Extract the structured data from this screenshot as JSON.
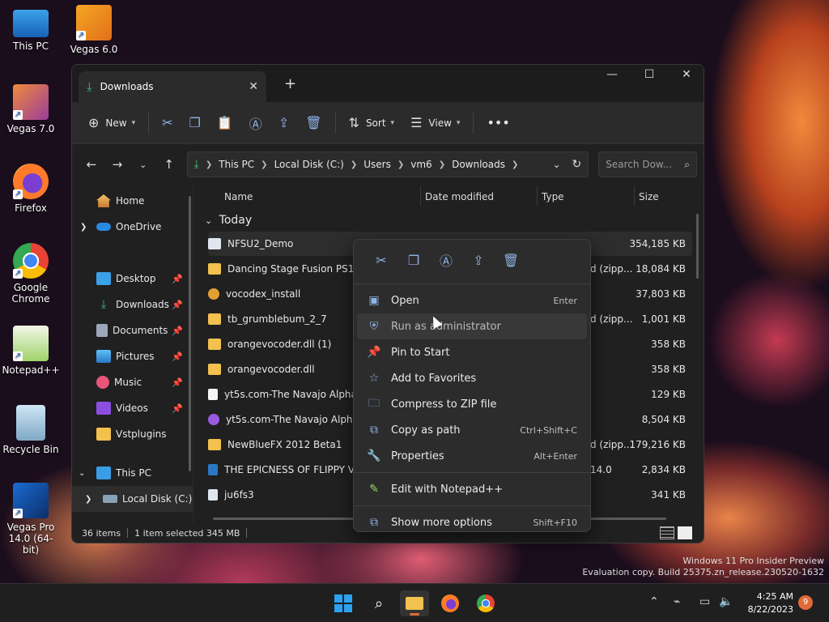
{
  "desktop": {
    "icons": [
      {
        "label": "This PC"
      },
      {
        "label": "Vegas 6.0"
      },
      {
        "label": "Vegas 7.0"
      },
      {
        "label": "Firefox"
      },
      {
        "label": "Google Chrome"
      },
      {
        "label": "Notepad++"
      },
      {
        "label": "Recycle Bin"
      },
      {
        "label": "Vegas Pro 14.0 (64-bit)"
      }
    ]
  },
  "window": {
    "tab_title": "Downloads",
    "toolbar": {
      "new_label": "New",
      "sort_label": "Sort",
      "view_label": "View"
    },
    "breadcrumb": [
      "This PC",
      "Local Disk (C:)",
      "Users",
      "vm6",
      "Downloads"
    ],
    "search_placeholder": "Search Dow...",
    "nav": [
      {
        "label": "Home"
      },
      {
        "label": "OneDrive"
      },
      {
        "label": "Desktop"
      },
      {
        "label": "Downloads"
      },
      {
        "label": "Documents"
      },
      {
        "label": "Pictures"
      },
      {
        "label": "Music"
      },
      {
        "label": "Videos"
      },
      {
        "label": "Vstplugins"
      },
      {
        "label": "This PC"
      },
      {
        "label": "Local Disk (C:)"
      }
    ],
    "columns": {
      "name": "Name",
      "date": "Date modified",
      "type": "Type",
      "size": "Size"
    },
    "group": "Today",
    "files": [
      {
        "name": "NFSU2_Demo",
        "type": "",
        "size": "354,185 KB"
      },
      {
        "name": "Dancing Stage Fusion PS1 (20",
        "type": "d (zipp...",
        "size": "18,084 KB"
      },
      {
        "name": "vocodex_install",
        "type": "",
        "size": "37,803 KB"
      },
      {
        "name": "tb_grumblebum_2_7",
        "type": "d (zipp...",
        "size": "1,001 KB"
      },
      {
        "name": "orangevocoder.dll (1)",
        "type": "",
        "size": "358 KB"
      },
      {
        "name": "orangevocoder.dll",
        "type": "",
        "size": "358 KB"
      },
      {
        "name": "yt5s.com-The Navajo Alphab",
        "type": "",
        "size": "129 KB"
      },
      {
        "name": "yt5s.com-The Navajo Alphab",
        "type": "",
        "size": "8,504 KB"
      },
      {
        "name": "NewBlueFX 2012 Beta1",
        "type": "d (zipp...",
        "size": "179,216 KB"
      },
      {
        "name": "THE EPICNESS OF FLIPPY VEG",
        "type": "14.0",
        "size": "2,834 KB"
      },
      {
        "name": "ju6fs3",
        "type": "",
        "size": "341 KB"
      }
    ],
    "status": {
      "count": "36 items",
      "selected": "1 item selected  345 MB"
    }
  },
  "context_menu": {
    "items": [
      {
        "label": "Open",
        "shortcut": "Enter"
      },
      {
        "label": "Run as administrator",
        "shortcut": ""
      },
      {
        "label": "Pin to Start",
        "shortcut": ""
      },
      {
        "label": "Add to Favorites",
        "shortcut": ""
      },
      {
        "label": "Compress to ZIP file",
        "shortcut": ""
      },
      {
        "label": "Copy as path",
        "shortcut": "Ctrl+Shift+C"
      },
      {
        "label": "Properties",
        "shortcut": "Alt+Enter"
      },
      {
        "label": "Edit with Notepad++",
        "shortcut": ""
      },
      {
        "label": "Show more options",
        "shortcut": "Shift+F10"
      }
    ]
  },
  "watermark": {
    "line1": "Windows 11 Pro Insider Preview",
    "line2": "Evaluation copy. Build 25375.zn_release.230520-1632"
  },
  "taskbar": {
    "time": "4:25 AM",
    "date": "8/22/2023",
    "badge": "9"
  },
  "colors": {
    "accent": "#3cc07a",
    "icon_blue": "#8fb4e8",
    "window_bg": "#202020",
    "menu_bg": "#2c2c2c"
  }
}
